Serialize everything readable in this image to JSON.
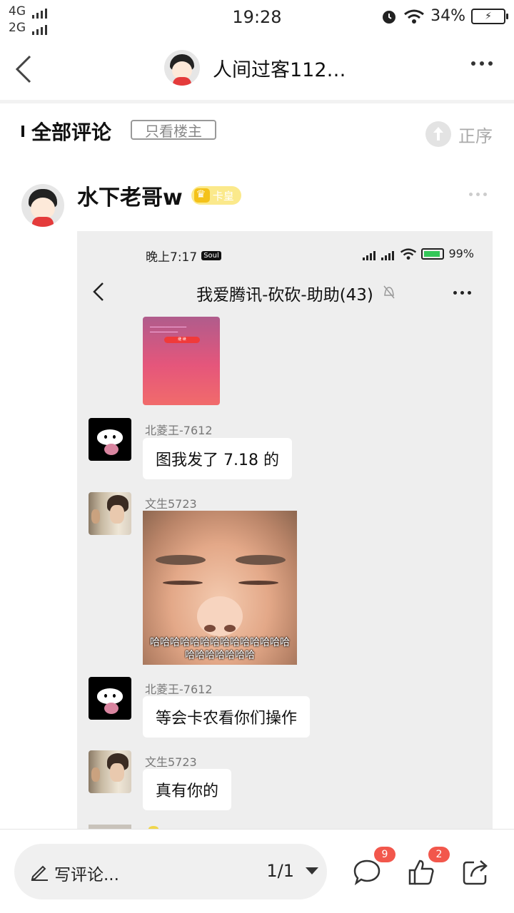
{
  "status_bar": {
    "network_1": "4G",
    "network_2": "2G",
    "time": "19:28",
    "battery": "34%",
    "icons": [
      "signal-bars-icon",
      "alarm-icon",
      "wifi-icon",
      "battery-charging-icon"
    ]
  },
  "header": {
    "title": "人间过客112…",
    "icons": [
      "back-arrow-icon",
      "more-dots-icon"
    ]
  },
  "comments": {
    "title": "全部评论",
    "filter_label": "只看楼主",
    "sort_label": "正序"
  },
  "post": {
    "author": "水下老哥w",
    "badge": "卡皇",
    "screenshot": {
      "status_time": "晚上7:17",
      "status_app": "Soul",
      "status_battery": "99%",
      "chat_title": "我爱腾讯-砍砍-助助(43)",
      "promo_button": "继 续",
      "messages": [
        {
          "sender": "北菱王-7612",
          "text": "图我发了 7.18 的"
        },
        {
          "sender": "文生5723",
          "image_caption": "哈哈哈哈哈哈哈哈哈哈哈哈哈哈哈哈哈哈哈哈哈"
        },
        {
          "sender": "北菱王-7612",
          "text": "等会卡农看你们操作"
        },
        {
          "sender": "文生5723",
          "text": "真有你的"
        }
      ]
    }
  },
  "bottom_bar": {
    "comment_placeholder": "写评论...",
    "page": "1/1",
    "comment_count": "9",
    "like_count": "2",
    "accent_color": "#f2574c"
  }
}
